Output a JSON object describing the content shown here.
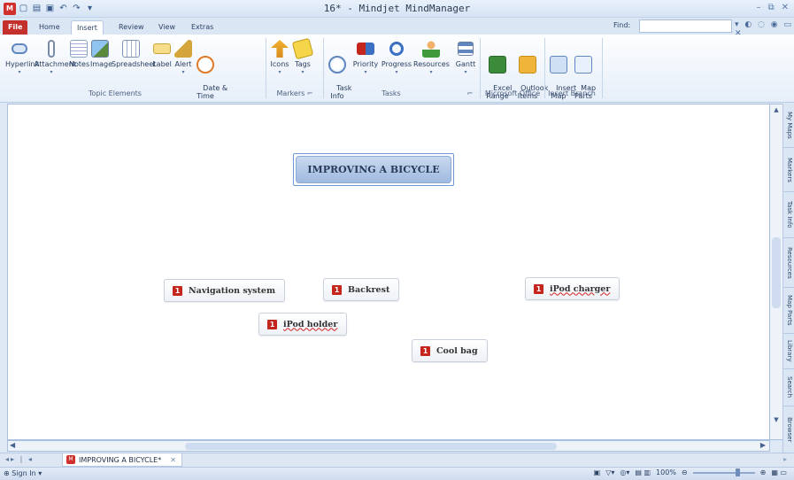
{
  "window": {
    "title": "16* - Mindjet MindManager",
    "controls": [
      "–",
      "⧉",
      "✕"
    ]
  },
  "ribbon_tabs": [
    "File",
    "Home",
    "Insert",
    "Review",
    "View",
    "Extras"
  ],
  "active_tab": "Insert",
  "find": {
    "label": "Find:",
    "value": ""
  },
  "ribbon": {
    "topic_elements": {
      "label": "Topic Elements",
      "buttons": [
        "Hyperlink",
        "Attachment",
        "Notes",
        "Image",
        "Spreadsheet",
        "Label",
        "Alert",
        "Date &\nTime"
      ]
    },
    "markers": {
      "label": "Markers",
      "buttons": [
        "Icons",
        "Tags"
      ]
    },
    "tasks": {
      "label": "Tasks",
      "buttons": [
        "Task\nInfo",
        "Priority",
        "Progress",
        "Resources",
        "Gantt"
      ]
    },
    "microsoft_office": {
      "label": "Microsoft Office",
      "buttons": [
        "Excel\nRange",
        "Outlook\nItems"
      ]
    },
    "insert_branch": {
      "label": "Insert Branch",
      "buttons": [
        "Insert\nMap",
        "Map\nParts"
      ]
    }
  },
  "map": {
    "central_topic": "IMPROVING A BICYCLE",
    "topics": [
      {
        "priority": "1",
        "label": "Navigation system"
      },
      {
        "priority": "1",
        "label": "Backrest"
      },
      {
        "priority": "1",
        "label": "iPod charger"
      },
      {
        "priority": "1",
        "label": "iPod holder"
      },
      {
        "priority": "1",
        "label": "Cool bag"
      }
    ]
  },
  "side_panels": [
    "My Maps",
    "Markers",
    "Task Info",
    "Resources",
    "Map Parts",
    "Library",
    "Search",
    "Browser"
  ],
  "document_tab": "IMPROVING A BICYCLE*",
  "status": {
    "sign_in": "Sign In",
    "zoom": "100%"
  }
}
